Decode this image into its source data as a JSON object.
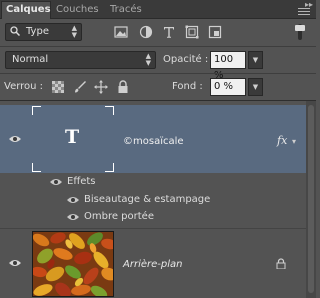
{
  "tabs": [
    "Calques",
    "Couches",
    "Tracés"
  ],
  "filter": {
    "kind": "Type"
  },
  "blend": {
    "mode": "Normal",
    "opacity_label": "Opacité :",
    "opacity_value": "100 %"
  },
  "lock": {
    "label": "Verrou :",
    "fill_label": "Fond :",
    "fill_value": "0 %"
  },
  "layers": {
    "text_layer": {
      "name": "©mosaïcale",
      "fx": "fx",
      "thumb_glyph": "T"
    },
    "effects": {
      "title": "Effets",
      "items": [
        "Biseautage & estampage",
        "Ombre portée"
      ]
    },
    "background_layer": {
      "name": "Arrière-plan"
    }
  },
  "colors": {
    "selected_layer": "#596a80",
    "panel_bg": "#535353"
  }
}
